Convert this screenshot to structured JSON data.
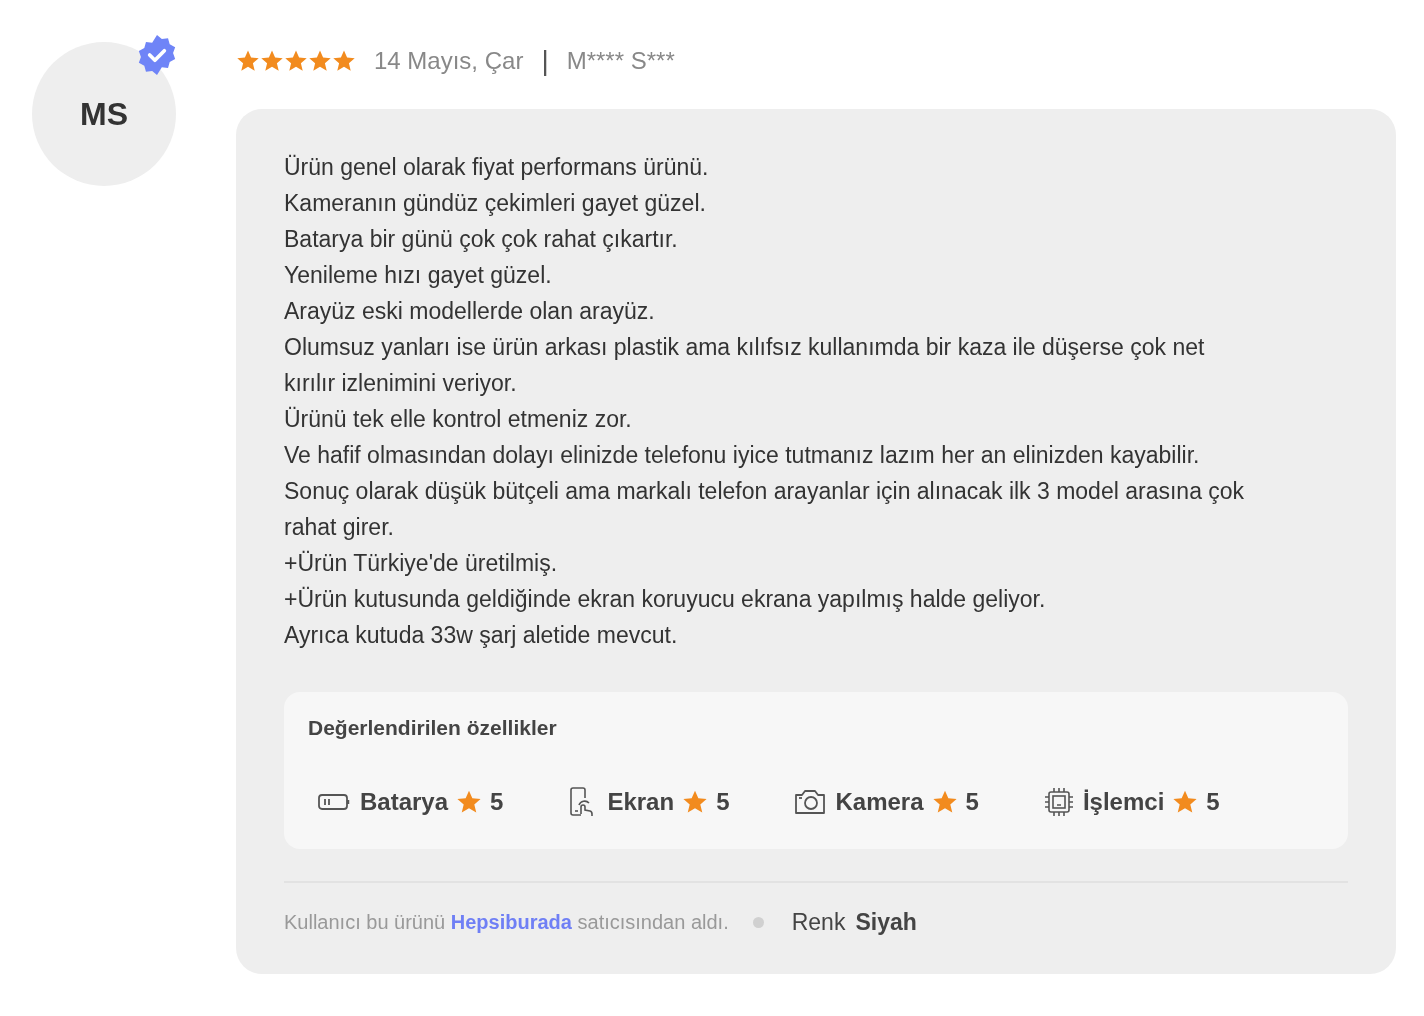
{
  "avatar": {
    "initials": "MS",
    "verified": true
  },
  "review": {
    "stars": 5,
    "date": "14 Mayıs, Çar",
    "separator": "|",
    "author": "M**** S***",
    "lines": [
      "Ürün genel olarak fiyat performans ürünü.",
      "Kameranın gündüz çekimleri gayet güzel.",
      "Batarya bir günü çok çok rahat çıkartır.",
      "Yenileme hızı gayet güzel.",
      "Arayüz eski modellerde olan arayüz.",
      "Olumsuz yanları ise ürün arkası plastik ama kılıfsız kullanımda bir kaza ile düşerse çok net kırılır izlenimini veriyor.",
      "Ürünü tek elle kontrol etmeniz zor.",
      "Ve hafif olmasından dolayı elinizde telefonu iyice tutmanız lazım her an elinizden kayabilir.",
      "Sonuç olarak düşük bütçeli ama markalı telefon arayanlar için alınacak ilk 3 model arasına çok rahat girer.",
      "+Ürün Türkiye'de üretilmiş.",
      "+Ürün kutusunda geldiğinde ekran koruyucu ekrana yapılmış halde geliyor.",
      "Ayrıca kutuda 33w şarj aletide mevcut."
    ]
  },
  "features": {
    "title": "Değerlendirilen özellikler",
    "items": [
      {
        "kind": "battery",
        "label": "Batarya",
        "score": "5"
      },
      {
        "kind": "screen",
        "label": "Ekran",
        "score": "5"
      },
      {
        "kind": "camera",
        "label": "Kamera",
        "score": "5"
      },
      {
        "kind": "cpu",
        "label": "İşlemci",
        "score": "5"
      }
    ]
  },
  "footer": {
    "seller_before": "Kullanıcı bu ürünü",
    "seller_link": "Hepsiburada",
    "seller_after": "satıcısından aldı.",
    "color_label": "Renk",
    "color_value": "Siyah"
  }
}
